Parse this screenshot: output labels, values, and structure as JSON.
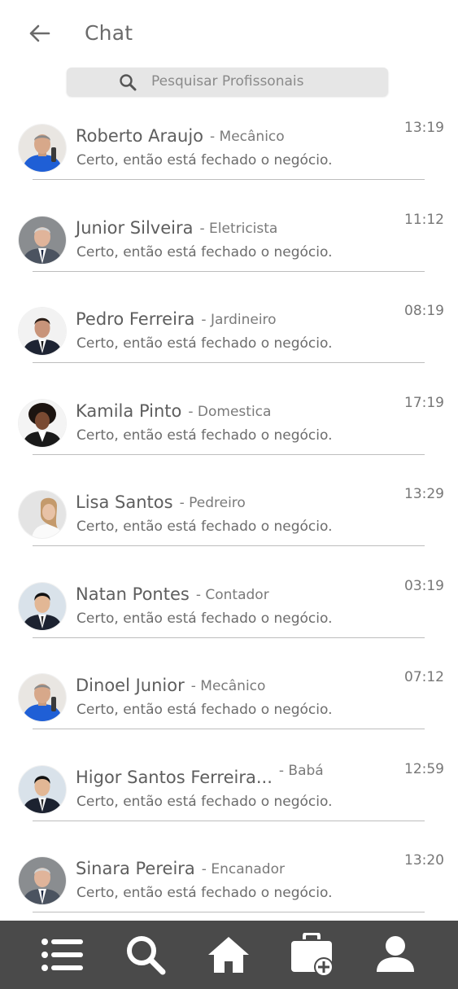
{
  "header": {
    "title": "Chat",
    "back_icon": "arrow-left-icon"
  },
  "search": {
    "placeholder": "Pesquisar Profissonais",
    "icon": "search-icon"
  },
  "chats": [
    {
      "name": "Roberto Araujo",
      "profession": "- Mecânico",
      "time": "13:19",
      "message": "Certo, então está fechado o negócio.",
      "avatar": "man-blue-shirt"
    },
    {
      "name": "Junior Silveira",
      "profession": "- Eletricista",
      "time": "11:12",
      "message": "Certo, então está fechado o negócio.",
      "avatar": "older-man-suit"
    },
    {
      "name": "Pedro Ferreira",
      "profession": "- Jardineiro",
      "time": "08:19",
      "message": "Certo, então está fechado o negócio.",
      "avatar": "man-dark-suit"
    },
    {
      "name": "Kamila Pinto",
      "profession": "- Domestica",
      "time": "17:19",
      "message": "Certo, então está fechado o negócio.",
      "avatar": "woman-curly-hair"
    },
    {
      "name": "Lisa Santos",
      "profession": "- Pedreiro",
      "time": "13:29",
      "message": "Certo, então está fechado o negócio.",
      "avatar": "woman-light"
    },
    {
      "name": "Natan Pontes",
      "profession": "- Contador",
      "time": "03:19",
      "message": "Certo, então está fechado o negócio.",
      "avatar": "young-man-suit"
    },
    {
      "name": "Dinoel Junior",
      "profession": "- Mecânico",
      "time": "07:12",
      "message": "Certo, então está fechado o negócio.",
      "avatar": "man-blue-shirt"
    },
    {
      "name": "Higor Santos Ferreira...",
      "profession": "- Babá",
      "time": "12:59",
      "message": "Certo, então está fechado o negócio.",
      "avatar": "young-man-suit"
    },
    {
      "name": "Sinara Pereira",
      "profession": "- Encanador",
      "time": "13:20",
      "message": "Certo, então está fechado o negócio.",
      "avatar": "older-man-suit"
    }
  ],
  "nav": {
    "items": [
      "list-icon",
      "search-icon",
      "home-icon",
      "briefcase-add-icon",
      "user-icon"
    ]
  },
  "colors": {
    "nav_background": "#4a4a4a",
    "search_background": "#e6e6e6",
    "divider": "#bdbdbd"
  }
}
